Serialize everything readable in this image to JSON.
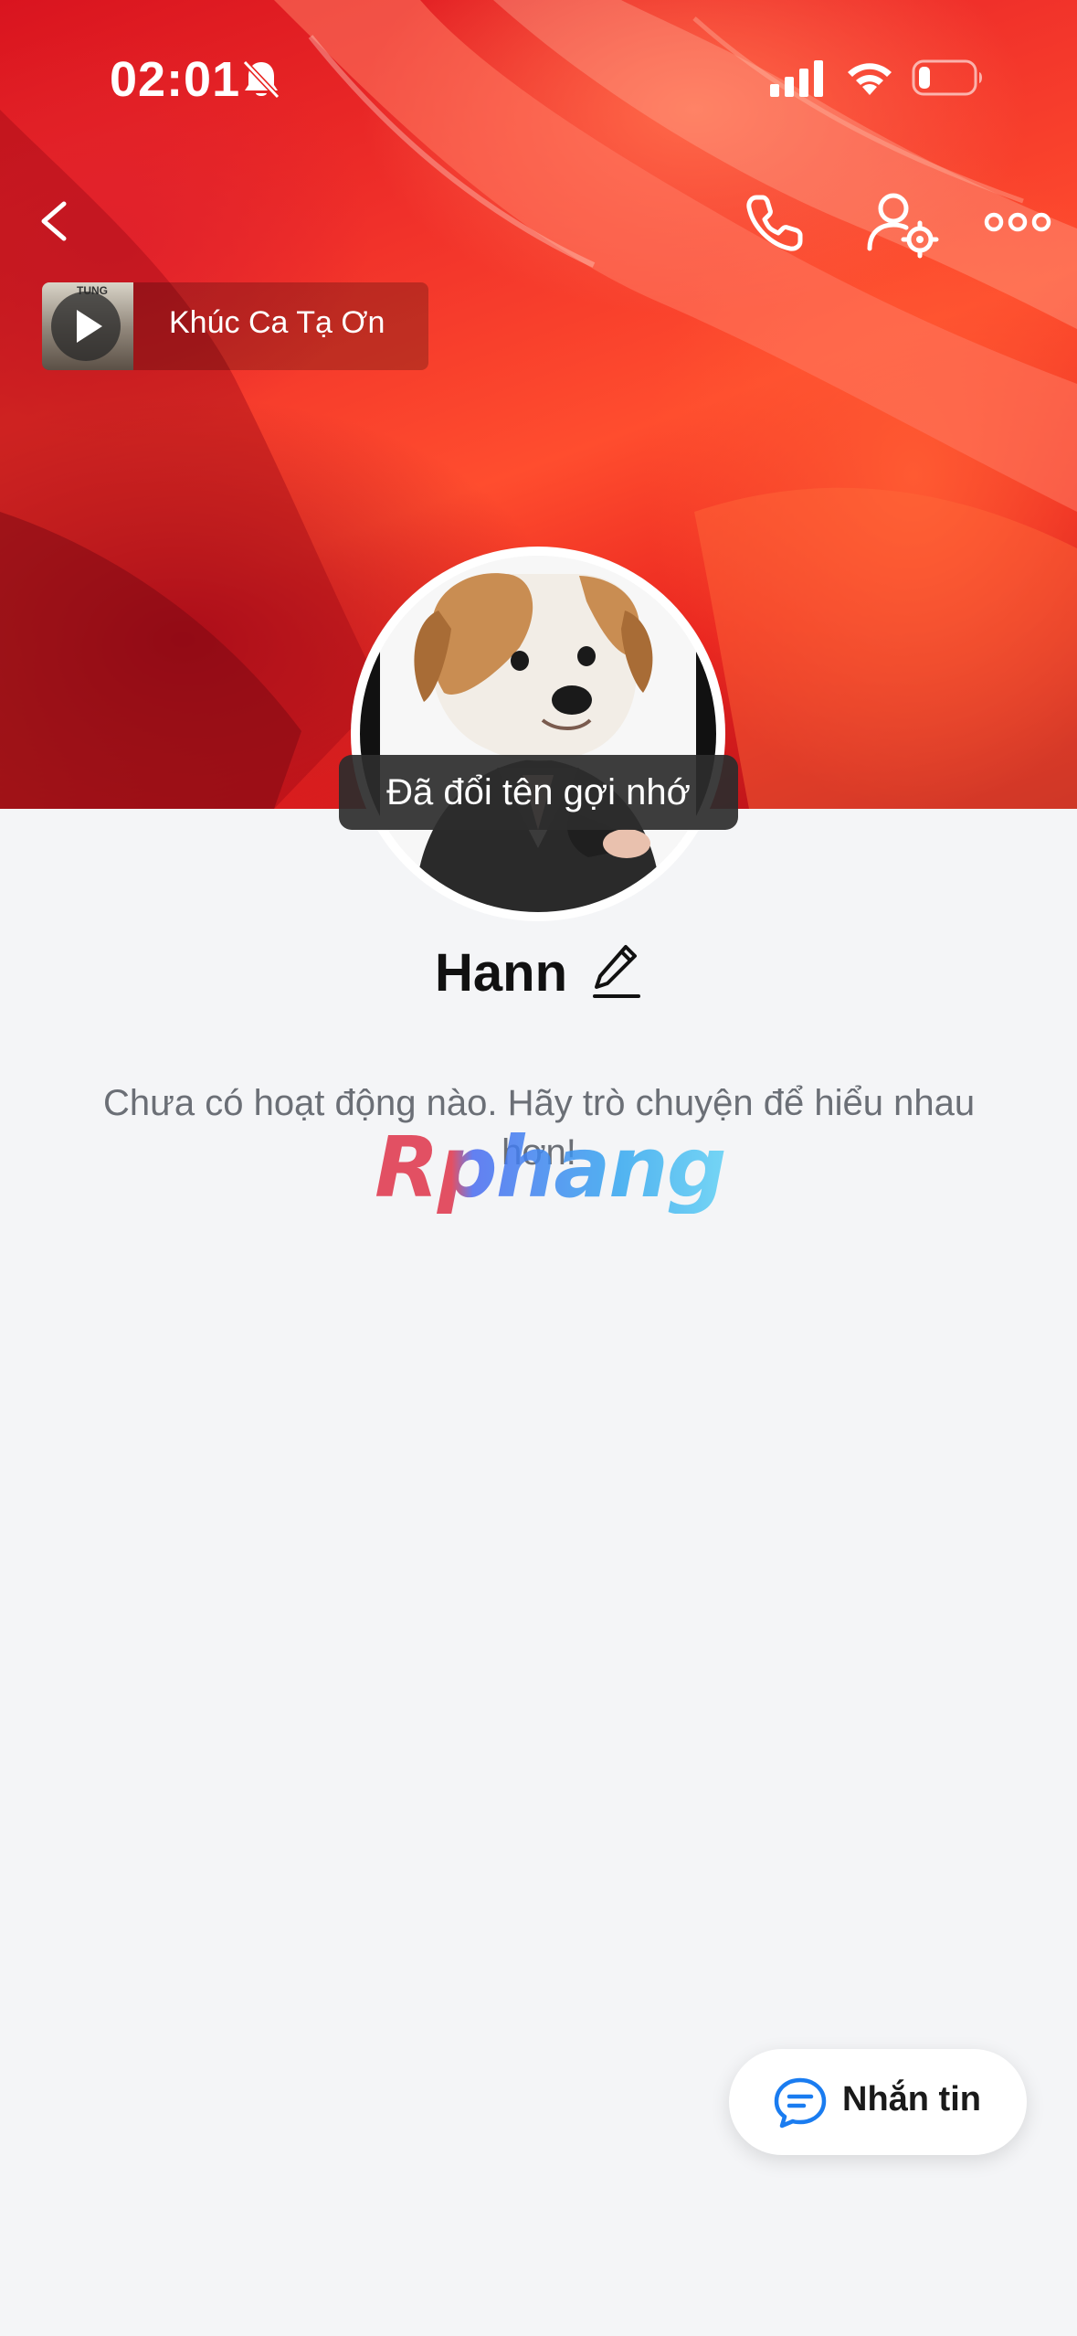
{
  "status_bar": {
    "time": "02:01",
    "icons": [
      "bell-slash-icon",
      "cellular-signal-icon",
      "wifi-icon",
      "battery-low-icon"
    ]
  },
  "header": {
    "back_icon": "chevron-left-icon",
    "actions": [
      "phone-icon",
      "user-settings-icon",
      "more-icon"
    ]
  },
  "music": {
    "thumb_label": "TUNG",
    "title": "Khúc Ca Tạ Ơn"
  },
  "toast": {
    "text": "Đã đổi tên gợi nhớ"
  },
  "profile": {
    "name": "Hann",
    "edit_icon": "pencil-icon"
  },
  "activity": {
    "empty_text": "Chưa có hoạt động nào. Hãy trò chuyện để hiểu nhau hơn!"
  },
  "watermark": "Rphang",
  "fab": {
    "label": "Nhắn tin",
    "icon": "chat-bubble-icon"
  },
  "colors": {
    "background": "#f4f5f7",
    "cover_red": "#e8231f",
    "accent_blue": "#1a7cf0",
    "toast_bg": "#2c2c2c"
  }
}
